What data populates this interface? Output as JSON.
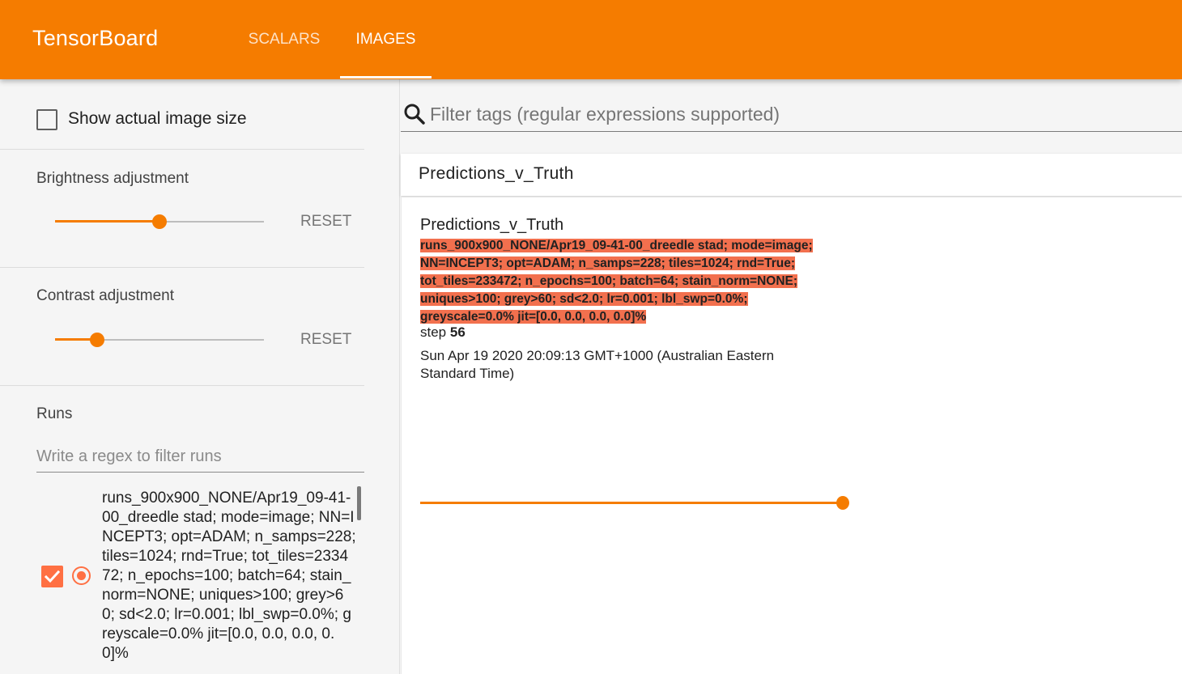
{
  "header": {
    "brand": "TensorBoard",
    "tabs": [
      {
        "label": "SCALARS"
      },
      {
        "label": "IMAGES"
      }
    ],
    "active_tab": "IMAGES",
    "accent_color": "#f57c00"
  },
  "sidebar": {
    "show_actual_size_label": "Show actual image size",
    "show_actual_size_checked": false,
    "brightness": {
      "title": "Brightness adjustment",
      "reset_label": "RESET",
      "value": 0.5
    },
    "contrast": {
      "title": "Contrast adjustment",
      "reset_label": "RESET",
      "value": 0.2
    },
    "runs": {
      "title": "Runs",
      "filter_placeholder": "Write a regex to filter runs",
      "items": [
        {
          "name": "runs_900x900_NONE/Apr19_09-41-00_dreedle stad; mode=image; NN=INCEPT3; opt=ADAM; n_samps=228; tiles=1024; rnd=True; tot_tiles=233472; n_epochs=100; batch=64; stain_norm=NONE; uniques>100; grey>60; sd<2.0; lr=0.001; lbl_swp=0.0%; greyscale=0.0% jit=[0.0, 0.0, 0.0, 0.0]%",
          "checked": true,
          "selected": true,
          "color": "#ff7043"
        }
      ]
    }
  },
  "main": {
    "filter_placeholder": "Filter tags (regular expressions supported)",
    "card": {
      "header_title": "Predictions_v_Truth",
      "image_title": "Predictions_v_Truth",
      "run_tag_lines": [
        " runs_900x900_NONE/Apr19_09-41-00_dreedle stad; mode=image;",
        "NN=INCEPT3; opt=ADAM; n_samps=228; tiles=1024; rnd=True;",
        "tot_tiles=233472; n_epochs=100; batch=64; stain_norm=NONE;",
        "uniques>100; grey>60; sd<2.0; lr=0.001; lbl_swp=0.0%;",
        "greyscale=0.0% jit=[0.0, 0.0, 0.0, 0.0]% "
      ],
      "run_tag_color": "#f2704e",
      "step_label": "step",
      "step_value": "56",
      "timestamp": "Sun Apr 19 2020 20:09:13 GMT+1000 (Australian Eastern Standard Time)",
      "step_position": 1.0
    }
  }
}
